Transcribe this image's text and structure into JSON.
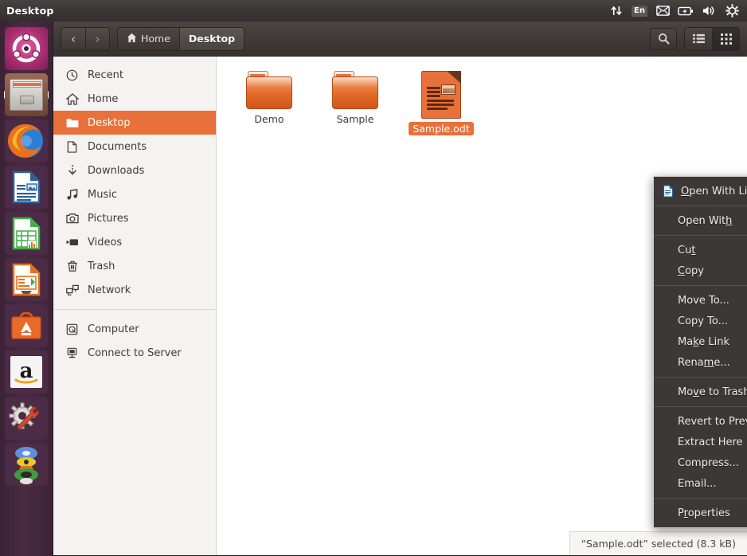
{
  "panel": {
    "title": "Desktop",
    "indicators": [
      {
        "name": "network-icon",
        "label": ""
      },
      {
        "name": "keyboard-layout-indicator",
        "label": "En"
      },
      {
        "name": "messaging-icon",
        "label": ""
      },
      {
        "name": "battery-icon",
        "label": ""
      },
      {
        "name": "volume-icon",
        "label": ""
      },
      {
        "name": "system-menu-icon",
        "label": ""
      }
    ]
  },
  "launcher": {
    "items": [
      {
        "name": "ubuntu-dash-icon",
        "label": "Ubuntu Dash"
      },
      {
        "name": "files-icon",
        "label": "Files"
      },
      {
        "name": "firefox-icon",
        "label": "Firefox"
      },
      {
        "name": "libreoffice-writer-icon",
        "label": "LibreOffice Writer"
      },
      {
        "name": "libreoffice-calc-icon",
        "label": "LibreOffice Calc"
      },
      {
        "name": "libreoffice-impress-icon",
        "label": "LibreOffice Impress"
      },
      {
        "name": "software-center-icon",
        "label": "Ubuntu Software"
      },
      {
        "name": "amazon-icon",
        "label": "Amazon"
      },
      {
        "name": "system-settings-icon",
        "label": "System Settings"
      },
      {
        "name": "workspace-switcher-icon",
        "label": "Workspace Switcher"
      }
    ]
  },
  "toolbar": {
    "back_label": "‹",
    "forward_label": "›",
    "breadcrumbs": [
      {
        "label": "Home",
        "icon": "home-icon",
        "active": false
      },
      {
        "label": "Desktop",
        "icon": "",
        "active": true
      }
    ],
    "search_label": "Search",
    "list_view_label": "List view",
    "grid_view_label": "Icon view"
  },
  "sidebar": {
    "items": [
      {
        "label": "Recent",
        "icon": "clock-icon",
        "selected": false
      },
      {
        "label": "Home",
        "icon": "home-icon",
        "selected": false
      },
      {
        "label": "Desktop",
        "icon": "folder-icon",
        "selected": true
      },
      {
        "label": "Documents",
        "icon": "document-icon",
        "selected": false
      },
      {
        "label": "Downloads",
        "icon": "download-icon",
        "selected": false
      },
      {
        "label": "Music",
        "icon": "music-icon",
        "selected": false
      },
      {
        "label": "Pictures",
        "icon": "camera-icon",
        "selected": false
      },
      {
        "label": "Videos",
        "icon": "video-icon",
        "selected": false
      },
      {
        "label": "Trash",
        "icon": "trash-icon",
        "selected": false
      },
      {
        "label": "Network",
        "icon": "network-icon",
        "selected": false
      }
    ],
    "items2": [
      {
        "label": "Computer",
        "icon": "computer-icon",
        "selected": false
      },
      {
        "label": "Connect to Server",
        "icon": "server-icon",
        "selected": false
      }
    ]
  },
  "files": [
    {
      "label": "Demo",
      "type": "folder",
      "selected": false
    },
    {
      "label": "Sample",
      "type": "folder",
      "selected": false
    },
    {
      "label": "Sample.odt",
      "type": "odt",
      "selected": true
    }
  ],
  "context_menu": {
    "groups": [
      [
        {
          "label": "Open With LibreOffice Writer",
          "mnemonic": "O",
          "icon": "writer-document-icon",
          "submenu": false
        }
      ],
      [
        {
          "label": "Open With",
          "mnemonic": "h",
          "icon": "",
          "submenu": true
        }
      ],
      [
        {
          "label": "Cut",
          "mnemonic": "t",
          "icon": "",
          "submenu": false
        },
        {
          "label": "Copy",
          "mnemonic": "C",
          "icon": "",
          "submenu": false
        }
      ],
      [
        {
          "label": "Move To...",
          "mnemonic": "",
          "icon": "",
          "submenu": false
        },
        {
          "label": "Copy To...",
          "mnemonic": "",
          "icon": "",
          "submenu": false
        },
        {
          "label": "Make Link",
          "mnemonic": "k",
          "icon": "",
          "submenu": false
        },
        {
          "label": "Rename...",
          "mnemonic": "m",
          "icon": "",
          "submenu": false
        }
      ],
      [
        {
          "label": "Move to Trash",
          "mnemonic": "v",
          "icon": "",
          "submenu": false
        }
      ],
      [
        {
          "label": "Revert to Previous Version...",
          "mnemonic": "",
          "icon": "",
          "submenu": false
        },
        {
          "label": "Extract Here",
          "mnemonic": "",
          "icon": "",
          "submenu": false
        },
        {
          "label": "Compress...",
          "mnemonic": "",
          "icon": "",
          "submenu": false
        },
        {
          "label": "Email...",
          "mnemonic": "",
          "icon": "",
          "submenu": false
        }
      ],
      [
        {
          "label": "Properties",
          "mnemonic": "r",
          "icon": "",
          "submenu": false
        }
      ]
    ],
    "submenu_arrow": "›"
  },
  "statusbar": {
    "text": "“Sample.odt” selected (8.3 kB)"
  },
  "colors": {
    "accent_orange": "#e8703a",
    "panel_dark": "#3b3736",
    "menu_bg": "#3c3835",
    "launcher_purple": "#4a2a42"
  }
}
